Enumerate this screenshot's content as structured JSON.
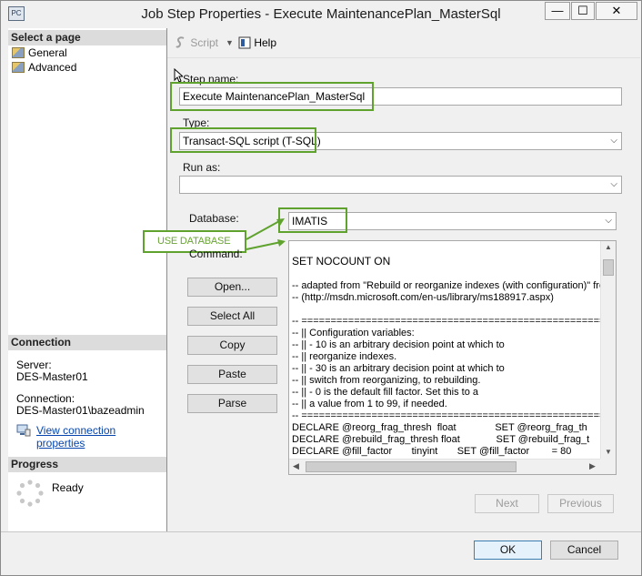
{
  "window": {
    "title": "Job Step Properties - Execute MaintenancePlan_MasterSql",
    "app_icon_text": "PC",
    "minimize_glyph": "—",
    "maximize_glyph": "☐",
    "close_glyph": "✕"
  },
  "left_pane": {
    "select_page_header": "Select a page",
    "pages": [
      {
        "label": "General"
      },
      {
        "label": "Advanced"
      }
    ],
    "connection_header": "Connection",
    "server_label": "Server:",
    "server_value": "DES-Master01",
    "connection_label": "Connection:",
    "connection_value": "DES-Master01\\bazeadmin",
    "view_connection_link": "View connection properties",
    "progress_header": "Progress",
    "progress_status": "Ready"
  },
  "toolbar": {
    "script_label": "Script",
    "help_label": "Help"
  },
  "form": {
    "step_name_label": "Step name:",
    "step_name_value": "Execute MaintenancePlan_MasterSql",
    "type_label": "Type:",
    "type_value": "Transact-SQL script (T-SQL)",
    "run_as_label": "Run as:",
    "run_as_value": "",
    "database_label": "Database:",
    "database_value": "IMATIS",
    "command_label": "Command:",
    "annotation": "USE DATABASE"
  },
  "command_buttons": {
    "open": "Open...",
    "select_all": "Select All",
    "copy": "Copy",
    "paste": "Paste",
    "parse": "Parse"
  },
  "command_lines": [
    "",
    "SET NOCOUNT ON",
    "",
    "-- adapted from \"Rebuild or reorganize indexes (with configuration)\" from",
    "-- (http://msdn.microsoft.com/en-us/library/ms188917.aspx)",
    "",
    "-- =======================================================",
    "-- || Configuration variables:",
    "-- || - 10 is an arbitrary decision point at which to",
    "-- || reorganize indexes.",
    "-- || - 30 is an arbitrary decision point at which to",
    "-- || switch from reorganizing, to rebuilding.",
    "-- || - 0 is the default fill factor. Set this to a",
    "-- || a value from 1 to 99, if needed.",
    "-- =======================================================",
    "DECLARE @reorg_frag_thresh  float              SET @reorg_frag_th",
    "DECLARE @rebuild_frag_thresh float             SET @rebuild_frag_t",
    "DECLARE @fill_factor       tinyint       SET @fill_factor        = 80"
  ],
  "nav_buttons": {
    "next": "Next",
    "previous": "Previous"
  },
  "footer": {
    "ok": "OK",
    "cancel": "Cancel"
  },
  "colors": {
    "annotation_green": "#5fa22e",
    "annotation_fill": "#6aa434",
    "link_blue": "#0645ad"
  }
}
